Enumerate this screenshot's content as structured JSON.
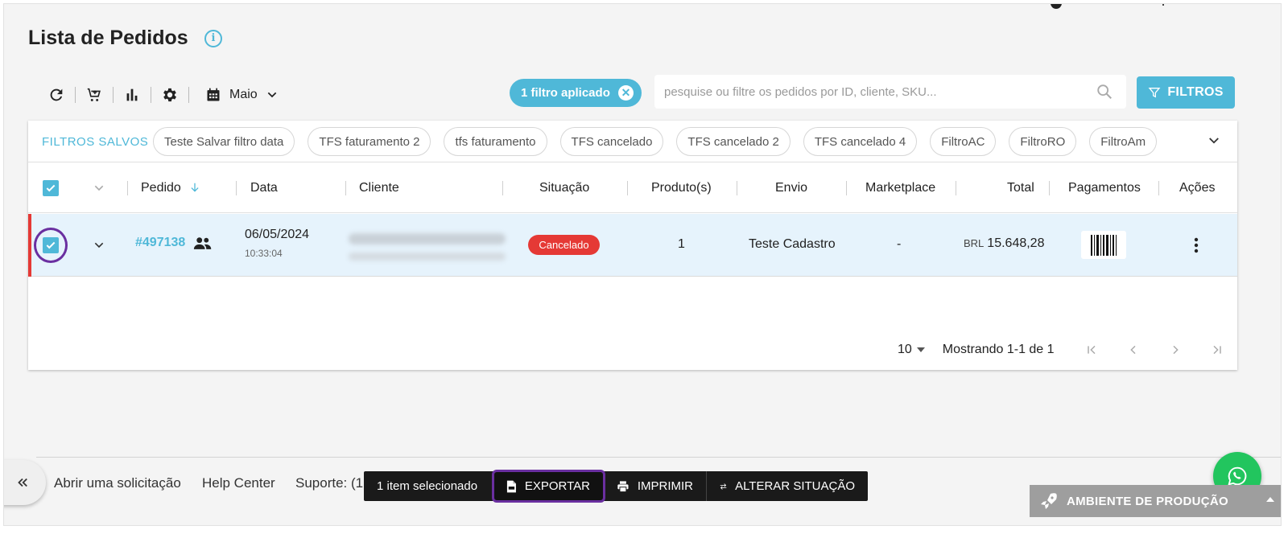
{
  "page": {
    "title": "Lista de Pedidos",
    "month": "Maio"
  },
  "filters": {
    "applied_label": "1 filtro aplicado",
    "search_placeholder": "pesquise ou filtre os pedidos por ID, cliente, SKU...",
    "filters_button": "FILTROS",
    "saved_label": "FILTROS SALVOS",
    "saved": [
      "Teste Salvar filtro data",
      "TFS faturamento 2",
      "tfs faturamento",
      "TFS cancelado",
      "TFS cancelado 2",
      "TFS cancelado 4",
      "FiltroAC",
      "FiltroRO",
      "FiltroAm"
    ]
  },
  "table": {
    "columns": {
      "pedido": "Pedido",
      "data": "Data",
      "cliente": "Cliente",
      "situacao": "Situação",
      "produtos": "Produto(s)",
      "envio": "Envio",
      "marketplace": "Marketplace",
      "total": "Total",
      "pagamentos": "Pagamentos",
      "acoes": "Ações"
    },
    "rows": [
      {
        "id": "#497138",
        "date": "06/05/2024",
        "time": "10:33:04",
        "status": "Cancelado",
        "products": "1",
        "shipping": "Teste Cadastro",
        "marketplace": "-",
        "currency": "BRL",
        "total": "15.648,28"
      }
    ]
  },
  "pagination": {
    "page_size": "10",
    "info": "Mostrando 1-1 de 1"
  },
  "footer": {
    "open_request": "Abrir uma solicitação",
    "help_center": "Help Center",
    "support": "Suporte: (1"
  },
  "action_bar": {
    "selected": "1 item selecionado",
    "export": "EXPORTAR",
    "print": "IMPRIMIR",
    "change_status": "ALTERAR SITUAÇÃO"
  },
  "environment": {
    "label": "AMBIENTE DE PRODUÇÃO"
  },
  "colors": {
    "accent": "#4fb8d8",
    "status_cancelled": "#e53935",
    "highlight_ring": "#6a2fa0",
    "whatsapp": "#22c55e"
  }
}
